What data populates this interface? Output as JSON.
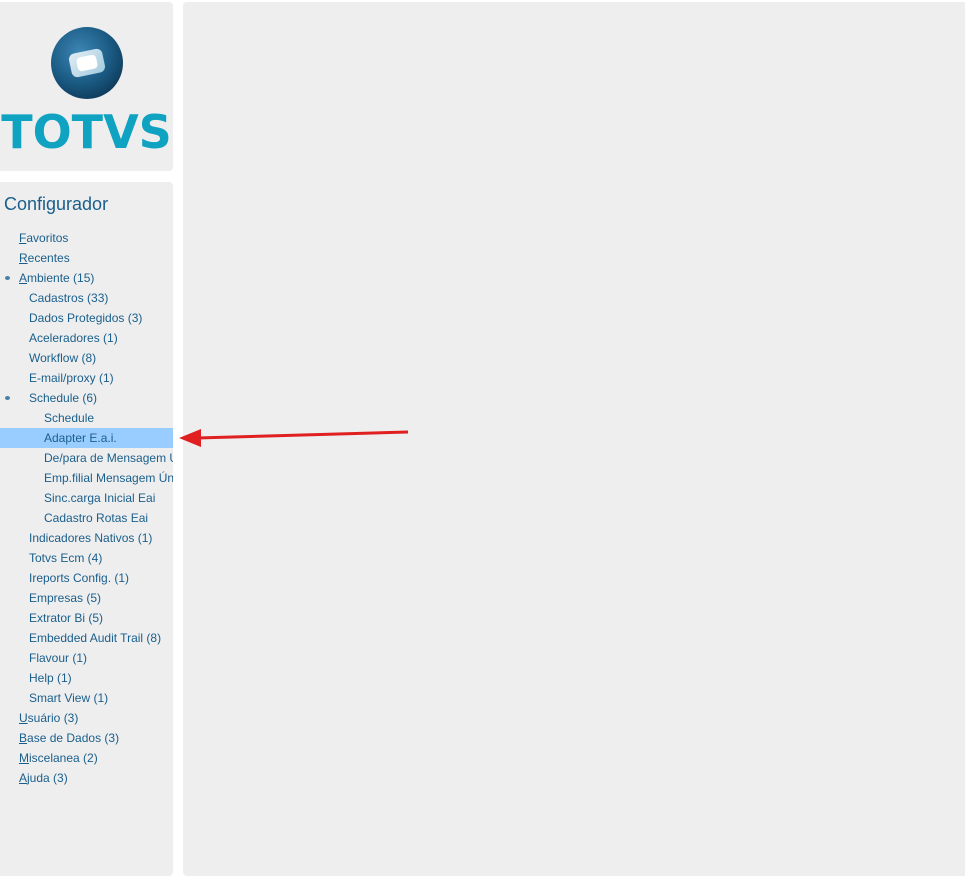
{
  "logo": {
    "text": "TOTVS",
    "brand_color": "#0fa3c1",
    "sphere_color": "#1b5c85",
    "icon": "totvs-sphere-icon"
  },
  "menu": {
    "title": "Configurador",
    "text_color": "#1a5f8c",
    "selected_color": "#99ccff",
    "items": [
      {
        "level": 1,
        "ak": "F",
        "rest": "avoritos",
        "bullet": false,
        "selected": false
      },
      {
        "level": 1,
        "ak": "R",
        "rest": "ecentes",
        "bullet": false,
        "selected": false
      },
      {
        "level": 1,
        "ak": "A",
        "rest": "mbiente (15)",
        "bullet": true,
        "selected": false
      },
      {
        "level": 2,
        "ak": "",
        "rest": "Cadastros (33)",
        "bullet": false,
        "selected": false
      },
      {
        "level": 2,
        "ak": "",
        "rest": "Dados Protegidos (3)",
        "bullet": false,
        "selected": false
      },
      {
        "level": 2,
        "ak": "",
        "rest": "Aceleradores (1)",
        "bullet": false,
        "selected": false
      },
      {
        "level": 2,
        "ak": "",
        "rest": "Workflow (8)",
        "bullet": false,
        "selected": false
      },
      {
        "level": 2,
        "ak": "",
        "rest": "E-mail/proxy (1)",
        "bullet": false,
        "selected": false
      },
      {
        "level": 2,
        "ak": "",
        "rest": "Schedule (6)",
        "bullet": true,
        "selected": false
      },
      {
        "level": 3,
        "ak": "",
        "rest": "Schedule",
        "bullet": false,
        "selected": false
      },
      {
        "level": 3,
        "ak": "",
        "rest": "Adapter E.a.i.",
        "bullet": false,
        "selected": true
      },
      {
        "level": 3,
        "ak": "",
        "rest": "De/para de Mensagem Ú",
        "bullet": false,
        "selected": false
      },
      {
        "level": 3,
        "ak": "",
        "rest": "Emp.filial Mensagem Ún",
        "bullet": false,
        "selected": false
      },
      {
        "level": 3,
        "ak": "",
        "rest": "Sinc.carga Inicial Eai",
        "bullet": false,
        "selected": false
      },
      {
        "level": 3,
        "ak": "",
        "rest": "Cadastro Rotas Eai",
        "bullet": false,
        "selected": false
      },
      {
        "level": 2,
        "ak": "",
        "rest": "Indicadores Nativos (1)",
        "bullet": false,
        "selected": false
      },
      {
        "level": 2,
        "ak": "",
        "rest": "Totvs Ecm (4)",
        "bullet": false,
        "selected": false
      },
      {
        "level": 2,
        "ak": "",
        "rest": "Ireports Config. (1)",
        "bullet": false,
        "selected": false
      },
      {
        "level": 2,
        "ak": "",
        "rest": "Empresas (5)",
        "bullet": false,
        "selected": false
      },
      {
        "level": 2,
        "ak": "",
        "rest": "Extrator Bi (5)",
        "bullet": false,
        "selected": false
      },
      {
        "level": 2,
        "ak": "",
        "rest": "Embedded Audit Trail (8)",
        "bullet": false,
        "selected": false
      },
      {
        "level": 2,
        "ak": "",
        "rest": "Flavour (1)",
        "bullet": false,
        "selected": false
      },
      {
        "level": 2,
        "ak": "",
        "rest": "Help (1)",
        "bullet": false,
        "selected": false
      },
      {
        "level": 2,
        "ak": "",
        "rest": "Smart View (1)",
        "bullet": false,
        "selected": false
      },
      {
        "level": 1,
        "ak": "U",
        "rest": "suário (3)",
        "bullet": false,
        "selected": false
      },
      {
        "level": 1,
        "ak": "B",
        "rest": "ase de Dados (3)",
        "bullet": false,
        "selected": false
      },
      {
        "level": 1,
        "ak": "M",
        "rest": "iscelanea (2)",
        "bullet": false,
        "selected": false
      },
      {
        "level": 1,
        "ak": "A",
        "rest": "juda (3)",
        "bullet": false,
        "selected": false
      }
    ]
  },
  "annotation": {
    "icon": "red-arrow-icon",
    "color": "#e02020"
  }
}
